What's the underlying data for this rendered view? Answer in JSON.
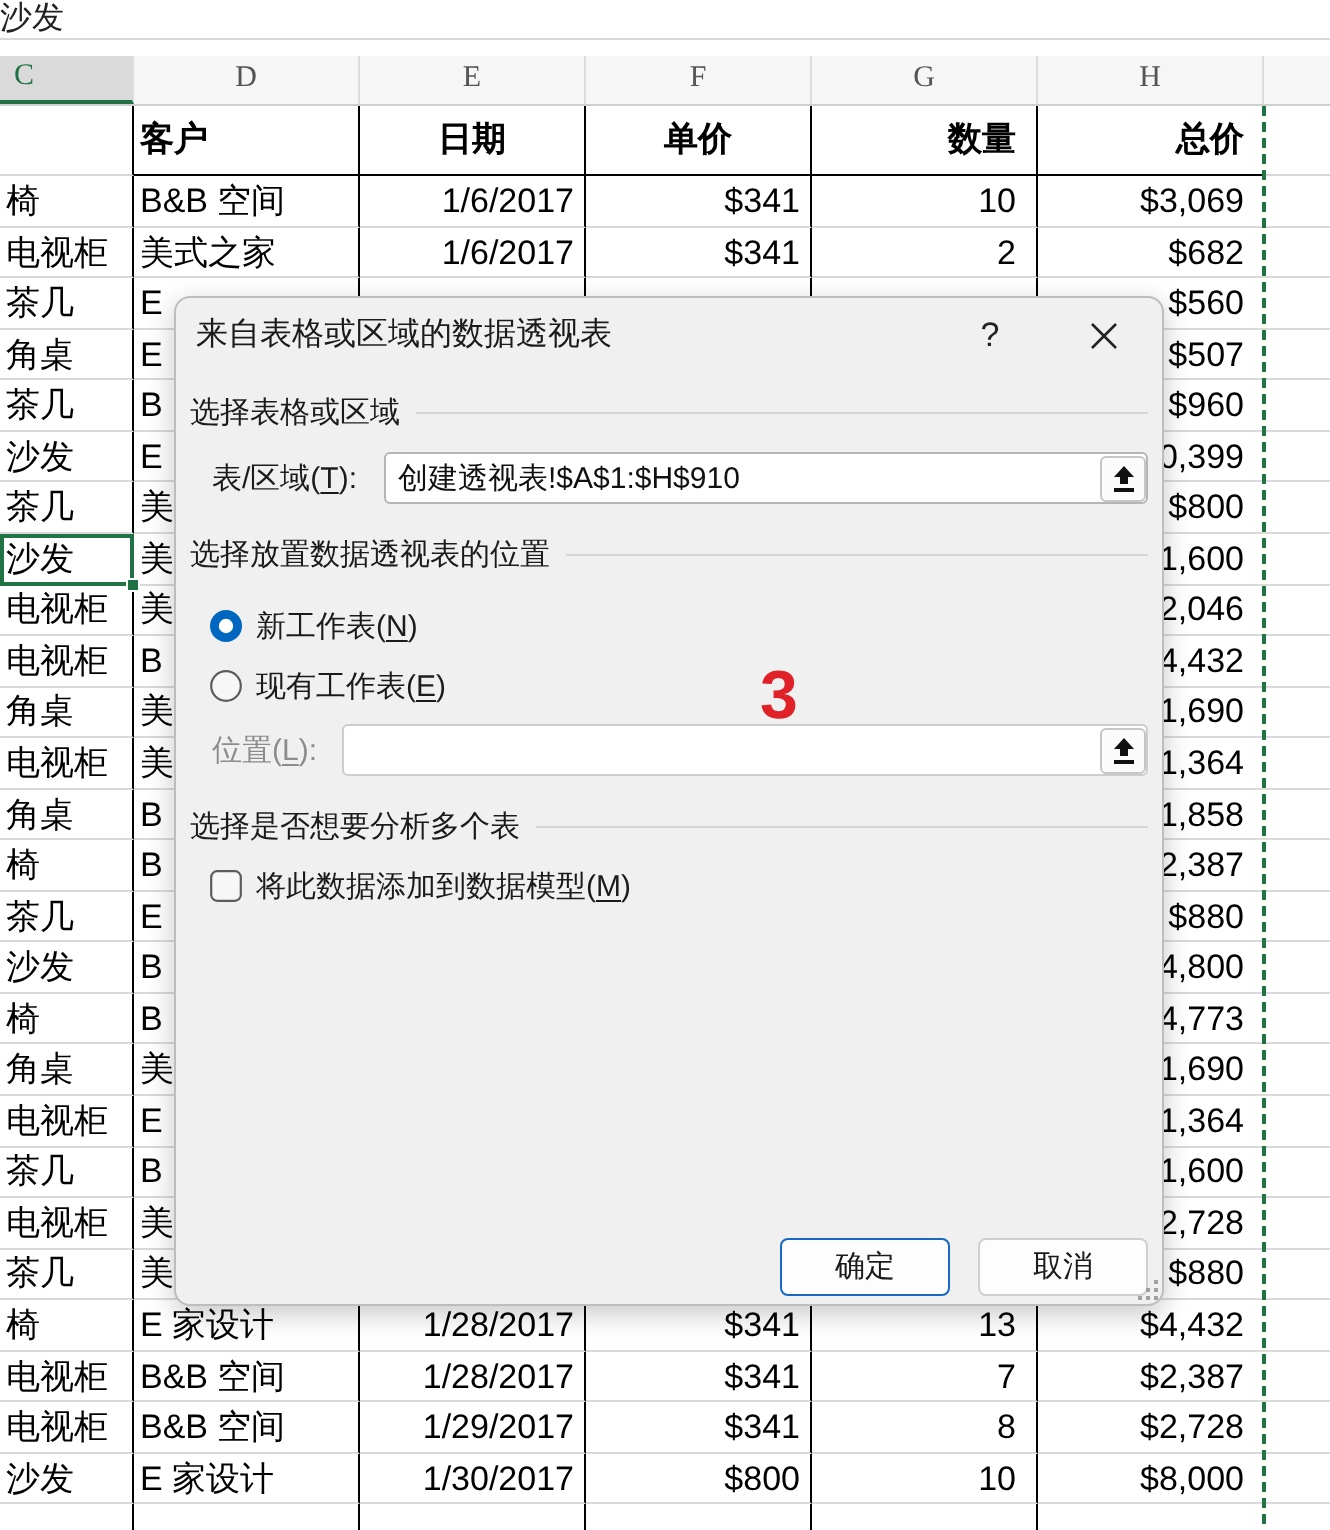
{
  "formula_bar": {
    "value": "沙发"
  },
  "sheet": {
    "column_headers": [
      {
        "label": "C",
        "selected": true
      },
      {
        "label": "D",
        "selected": false
      },
      {
        "label": "E",
        "selected": false
      },
      {
        "label": "F",
        "selected": false
      },
      {
        "label": "G",
        "selected": false
      },
      {
        "label": "H",
        "selected": false
      }
    ],
    "header_row": {
      "customer": "客户",
      "date": "日期",
      "unit_price": "单价",
      "quantity": "数量",
      "total": "总价"
    },
    "rows": [
      {
        "column_c": "椅",
        "customer": "B&B 空间",
        "date": "1/6/2017",
        "unit_price": "$341",
        "quantity": "10",
        "total": "$3,069",
        "selected": false
      },
      {
        "column_c": "电视柜",
        "customer": "美式之家",
        "date": "1/6/2017",
        "unit_price": "$341",
        "quantity": "2",
        "total": "$682",
        "selected": false
      },
      {
        "column_c": "茶几",
        "customer": "E",
        "total": "$560",
        "selected": false
      },
      {
        "column_c": "角桌",
        "customer": "E",
        "total": "$507",
        "selected": false
      },
      {
        "column_c": "茶几",
        "customer": "B",
        "total": "$960",
        "selected": false
      },
      {
        "column_c": "沙发",
        "customer": "E",
        "total": "0,399",
        "selected": false
      },
      {
        "column_c": "茶几",
        "customer": "美",
        "total": "$800",
        "selected": false
      },
      {
        "column_c": "沙发",
        "customer": "美",
        "total": "1,600",
        "selected": true
      },
      {
        "column_c": "电视柜",
        "customer": "美",
        "total": "2,046",
        "selected": false
      },
      {
        "column_c": "电视柜",
        "customer": "B",
        "total": "4,432",
        "selected": false
      },
      {
        "column_c": "角桌",
        "customer": "美",
        "total": "1,690",
        "selected": false
      },
      {
        "column_c": "电视柜",
        "customer": "美",
        "total": "1,364",
        "selected": false
      },
      {
        "column_c": "角桌",
        "customer": "B",
        "total": "1,858",
        "selected": false
      },
      {
        "column_c": "椅",
        "customer": "B",
        "total": "2,387",
        "selected": false
      },
      {
        "column_c": "茶几",
        "customer": "E",
        "total": "$880",
        "selected": false
      },
      {
        "column_c": "沙发",
        "customer": "B",
        "total": "4,800",
        "selected": false
      },
      {
        "column_c": "椅",
        "customer": "B",
        "total": "4,773",
        "selected": false
      },
      {
        "column_c": "角桌",
        "customer": "美",
        "total": "1,690",
        "selected": false
      },
      {
        "column_c": "电视柜",
        "customer": "E",
        "total": "1,364",
        "selected": false
      },
      {
        "column_c": "茶几",
        "customer": "B",
        "total": "1,600",
        "selected": false
      },
      {
        "column_c": "电视柜",
        "customer": "美",
        "total": "2,728",
        "selected": false
      },
      {
        "column_c": "茶几",
        "customer": "美",
        "total": "$880",
        "selected": false
      },
      {
        "column_c": "椅",
        "customer": "E 家设计",
        "date": "1/28/2017",
        "unit_price": "$341",
        "quantity": "13",
        "total": "$4,432",
        "selected": false
      },
      {
        "column_c": "电视柜",
        "customer": "B&B 空间",
        "date": "1/28/2017",
        "unit_price": "$341",
        "quantity": "7",
        "total": "$2,387",
        "selected": false
      },
      {
        "column_c": "电视柜",
        "customer": "B&B 空间",
        "date": "1/29/2017",
        "unit_price": "$341",
        "quantity": "8",
        "total": "$2,728",
        "selected": false
      },
      {
        "column_c": "沙发",
        "customer": "E 家设计",
        "date": "1/30/2017",
        "unit_price": "$800",
        "quantity": "10",
        "total": "$8,000",
        "selected": false
      }
    ]
  },
  "dialog": {
    "title": "来自表格或区域的数据透视表",
    "help_button": "?",
    "source": {
      "heading": "选择表格或区域",
      "field": {
        "label_start": "表/区域(",
        "access_key": "T",
        "label_end": "):",
        "value": "创建透视表!$A$1:$H$910",
        "disabled": false
      }
    },
    "placement": {
      "heading": "选择放置数据透视表的位置",
      "options": [
        {
          "label_start": "新工作表(",
          "access_key": "N",
          "label_end": ")",
          "selected": true
        },
        {
          "label_start": "现有工作表(",
          "access_key": "E",
          "label_end": ")",
          "selected": false
        }
      ],
      "field": {
        "label_start": "位置(",
        "access_key": "L",
        "label_end": "):",
        "disabled": true
      }
    },
    "multiple_tables": {
      "heading": "选择是否想要分析多个表",
      "checkbox": {
        "label_start": "将此数据添加到数据模型(",
        "access_key": "M",
        "label_end": ")",
        "checked": false
      }
    },
    "buttons": [
      {
        "label": "确定",
        "default": true
      },
      {
        "label": "取消",
        "default": false
      }
    ]
  },
  "annotation": {
    "text": "3"
  }
}
